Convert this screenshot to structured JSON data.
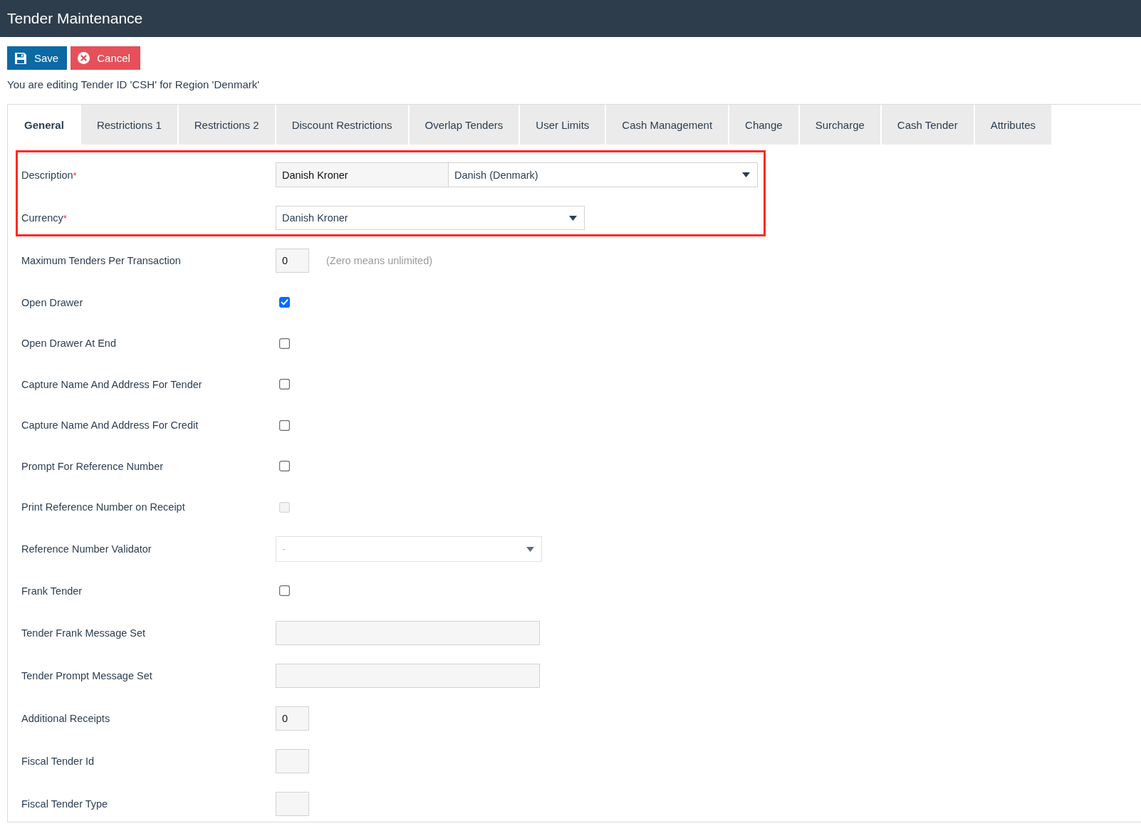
{
  "window": {
    "title": "Tender Maintenance"
  },
  "toolbar": {
    "buttons": [
      {
        "kind": "save",
        "label": "Save"
      },
      {
        "kind": "cancel",
        "label": "Cancel"
      }
    ]
  },
  "context_message": "You are editing Tender ID 'CSH' for Region 'Denmark'",
  "tabs": [
    {
      "label": "General",
      "selected": true
    },
    {
      "label": "Restrictions 1",
      "selected": false
    },
    {
      "label": "Restrictions 2",
      "selected": false
    },
    {
      "label": "Discount Restrictions",
      "selected": false
    },
    {
      "label": "Overlap Tenders",
      "selected": false
    },
    {
      "label": "User Limits",
      "selected": false
    },
    {
      "label": "Cash Management",
      "selected": false
    },
    {
      "label": "Change",
      "selected": false
    },
    {
      "label": "Surcharge",
      "selected": false
    },
    {
      "label": "Cash Tender",
      "selected": false
    },
    {
      "label": "Attributes",
      "selected": false
    }
  ],
  "form": {
    "highlighted_fields": [
      {
        "label": "Description",
        "required_mark": "*",
        "kind": "text_with_select",
        "value": "Danish Kroner",
        "select_value": "Danish (Denmark)",
        "disabled": false
      },
      {
        "label": "Currency",
        "required_mark": "*",
        "kind": "select",
        "value": "Danish Kroner",
        "disabled": false
      }
    ],
    "fields": [
      {
        "label": "Maximum Tenders Per Transaction",
        "kind": "number",
        "value": "0",
        "hint": "(Zero means unlimited)",
        "disabled": false
      },
      {
        "label": "Open Drawer",
        "kind": "checkbox",
        "checked": true,
        "disabled": false
      },
      {
        "label": "Open Drawer At End",
        "kind": "checkbox",
        "checked": false,
        "disabled": false
      },
      {
        "label": "Capture Name And Address For Tender",
        "kind": "checkbox",
        "checked": false,
        "disabled": false
      },
      {
        "label": "Capture Name And Address For Credit",
        "kind": "checkbox",
        "checked": false,
        "disabled": false
      },
      {
        "label": "Prompt For Reference Number",
        "kind": "checkbox",
        "checked": false,
        "disabled": false
      },
      {
        "label": "Print Reference Number on Receipt",
        "kind": "checkbox",
        "checked": false,
        "disabled": true
      },
      {
        "label": "Reference Number Validator",
        "kind": "select",
        "value": "-",
        "disabled": true
      },
      {
        "label": "Frank Tender",
        "kind": "checkbox",
        "checked": false,
        "disabled": false
      },
      {
        "label": "Tender Frank Message Set",
        "kind": "text",
        "disabled": false
      },
      {
        "label": "Tender Prompt Message Set",
        "kind": "text",
        "disabled": false
      },
      {
        "label": "Additional Receipts",
        "kind": "number",
        "value": "0",
        "disabled": false
      },
      {
        "label": "Fiscal Tender Id",
        "kind": "number",
        "disabled": false
      },
      {
        "label": "Fiscal Tender Type",
        "kind": "number",
        "disabled": false
      }
    ]
  }
}
